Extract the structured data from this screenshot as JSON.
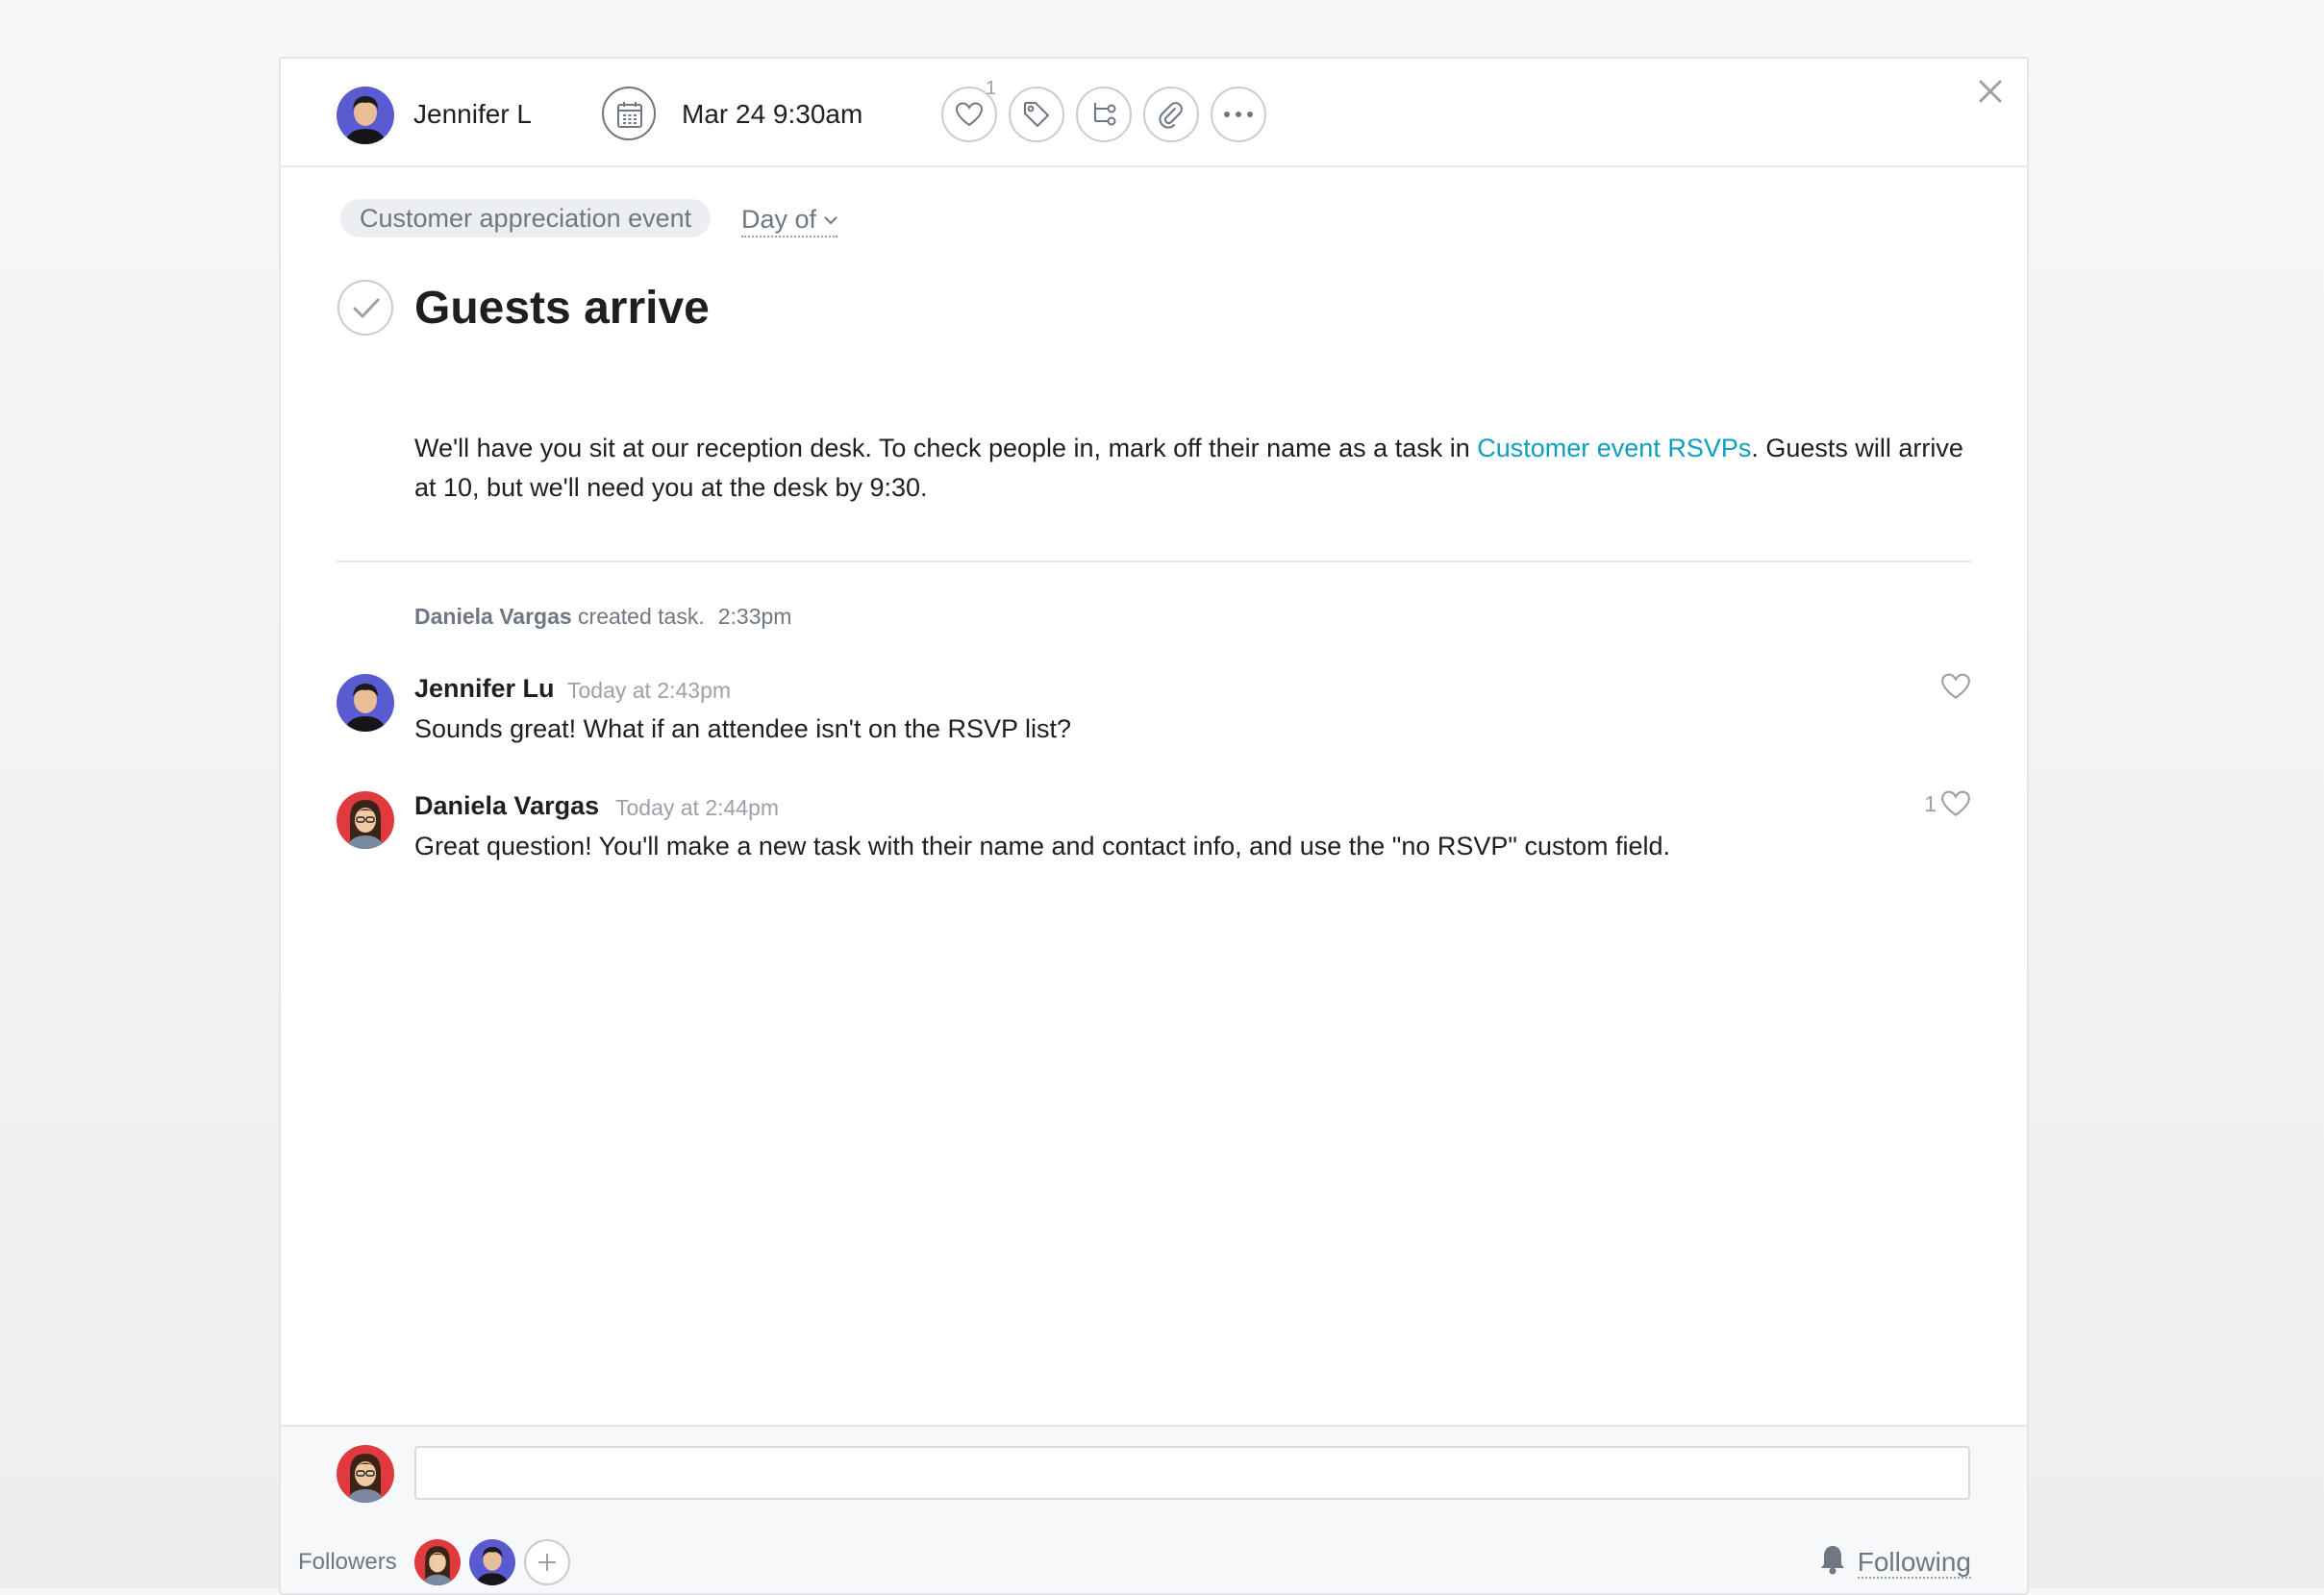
{
  "header": {
    "assignee_name": "Jennifer L",
    "due_date": "Mar 24 9:30am",
    "like_count": "1"
  },
  "task": {
    "project": "Customer appreciation event",
    "section": "Day of",
    "title": "Guests arrive",
    "description_before": "We'll have you sit at our reception desk. To check people in, mark off their name as a task in ",
    "description_link": "Customer event RSVPs",
    "description_after": ". Guests will arrive at 10, but we'll need you at the desk by 9:30."
  },
  "activity": {
    "story": {
      "author": "Daniela Vargas",
      "action": " created task.",
      "time": "2:33pm"
    },
    "comments": [
      {
        "author": "Jennifer Lu",
        "time": "Today at 2:43pm",
        "text": "Sounds great! What if an attendee isn't on the RSVP list?",
        "likes": ""
      },
      {
        "author": "Daniela Vargas",
        "time": "Today at 2:44pm",
        "text": "Great question! You'll make a new task with their name and contact info, and use the \"no RSVP\" custom field.",
        "likes": "1"
      }
    ]
  },
  "composer": {
    "placeholder": ""
  },
  "footer": {
    "followers_label": "Followers",
    "following_label": "Following"
  },
  "colors": {
    "link": "#0d9fc2",
    "jennifer_avatar_bg": "#5a5bd0",
    "daniela_avatar_bg": "#e0393e"
  }
}
